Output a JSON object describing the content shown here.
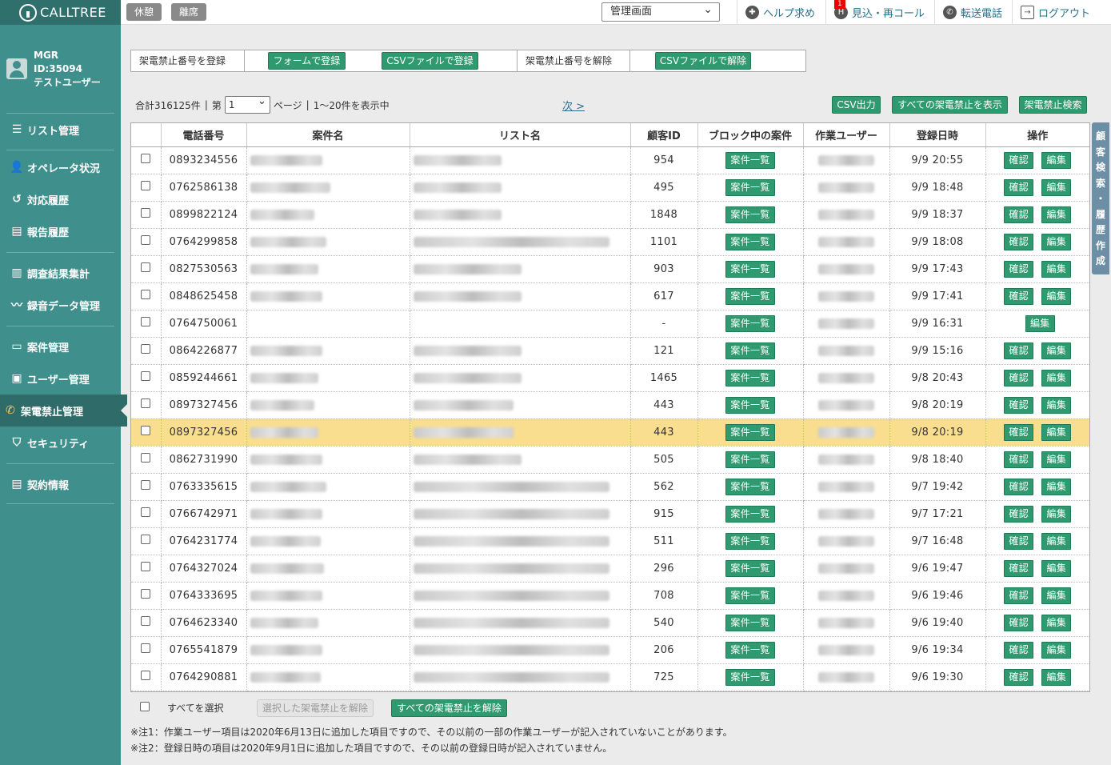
{
  "brand": "CALLTREE",
  "user": {
    "role": "MGR",
    "id": "ID:35094",
    "name": "テストユーザー"
  },
  "sidebar": {
    "items": [
      {
        "label": "リスト管理",
        "icon": "list-icon"
      },
      {
        "label": "オペレータ状況",
        "icon": "operator-icon"
      },
      {
        "label": "対応履歴",
        "icon": "history-icon"
      },
      {
        "label": "報告履歴",
        "icon": "report-icon"
      },
      {
        "label": "調査結果集計",
        "icon": "survey-icon"
      },
      {
        "label": "録音データ管理",
        "icon": "audio-icon"
      },
      {
        "label": "案件管理",
        "icon": "folder-icon"
      },
      {
        "label": "ユーザー管理",
        "icon": "id-card-icon"
      },
      {
        "label": "架電禁止管理",
        "icon": "phone-block-icon"
      },
      {
        "label": "セキュリティ",
        "icon": "shield-icon"
      },
      {
        "label": "契約情報",
        "icon": "contract-icon"
      }
    ]
  },
  "topbar": {
    "break_label": "休憩",
    "away_label": "離席",
    "screen_select": "管理画面",
    "help_label": "ヘルプ求め",
    "callback_label": "見込・再コール",
    "callback_badge": "1",
    "transfer_label": "転送電話",
    "logout_label": "ログアウト"
  },
  "register": {
    "register_label": "架電禁止番号を登録",
    "form_button": "フォームで登録",
    "csv_register_button": "CSVファイルで登録",
    "unregister_label": "架電禁止番号を解除",
    "csv_unregister_button": "CSVファイルで解除"
  },
  "pager": {
    "total": "合計316125件",
    "sep1": "|",
    "page_prefix": "第",
    "page_value": "1",
    "page_suffix": "ページ",
    "sep2": "|",
    "range": "1～20件を表示中",
    "next": "次 >"
  },
  "actions": {
    "csv_output": "CSV出力",
    "show_all": "すべての架電禁止を表示",
    "search": "架電禁止検索"
  },
  "table": {
    "headers": [
      "",
      "電話番号",
      "案件名",
      "リスト名",
      "顧客ID",
      "ブロック中の案件",
      "作業ユーザー",
      "登録日時",
      "操作"
    ],
    "case_button": "案件一覧",
    "confirm_button": "確認",
    "edit_button": "編集",
    "rows": [
      {
        "phone": "0893234556",
        "customer_id": "954",
        "date": "9/9 20:55"
      },
      {
        "phone": "0762586138",
        "customer_id": "495",
        "date": "9/9 18:48"
      },
      {
        "phone": "0899822124",
        "customer_id": "1848",
        "date": "9/9 18:37"
      },
      {
        "phone": "0764299858",
        "customer_id": "1101",
        "date": "9/9 18:08"
      },
      {
        "phone": "0827530563",
        "customer_id": "903",
        "date": "9/9 17:43"
      },
      {
        "phone": "0848625458",
        "customer_id": "617",
        "date": "9/9 17:41"
      },
      {
        "phone": "0764750061",
        "customer_id": "-",
        "date": "9/9 16:31"
      },
      {
        "phone": "0864226877",
        "customer_id": "121",
        "date": "9/9 15:16"
      },
      {
        "phone": "0859244661",
        "customer_id": "1465",
        "date": "9/8 20:43"
      },
      {
        "phone": "0897327456",
        "customer_id": "443",
        "date": "9/8 20:19"
      },
      {
        "phone": "0897327456",
        "customer_id": "443",
        "date": "9/8 20:19"
      },
      {
        "phone": "0862731990",
        "customer_id": "505",
        "date": "9/8 18:40"
      },
      {
        "phone": "0763335615",
        "customer_id": "562",
        "date": "9/7 19:42"
      },
      {
        "phone": "0766742971",
        "customer_id": "915",
        "date": "9/7 17:21"
      },
      {
        "phone": "0764231774",
        "customer_id": "511",
        "date": "9/7 16:48"
      },
      {
        "phone": "0764327024",
        "customer_id": "296",
        "date": "9/6 19:47"
      },
      {
        "phone": "0764333695",
        "customer_id": "708",
        "date": "9/6 19:46"
      },
      {
        "phone": "0764623340",
        "customer_id": "540",
        "date": "9/6 19:40"
      },
      {
        "phone": "0765541879",
        "customer_id": "206",
        "date": "9/6 19:34"
      },
      {
        "phone": "0764290881",
        "customer_id": "725",
        "date": "9/6 19:30"
      }
    ]
  },
  "side_tab": "顧客検索・履歴作成",
  "footer": {
    "select_all": "すべてを選択",
    "remove_selected": "選択した架電禁止を解除",
    "remove_all": "すべての架電禁止を解除",
    "note1": "※注1：作業ユーザー項目は2020年6月13日に追加した項目ですので、その以前の一部の作業ユーザーが記入されていないことがあります。",
    "note2": "※注2：登録日時の項目は2020年9月1日に追加した項目ですので、その以前の登録日時が記入されていません。"
  }
}
